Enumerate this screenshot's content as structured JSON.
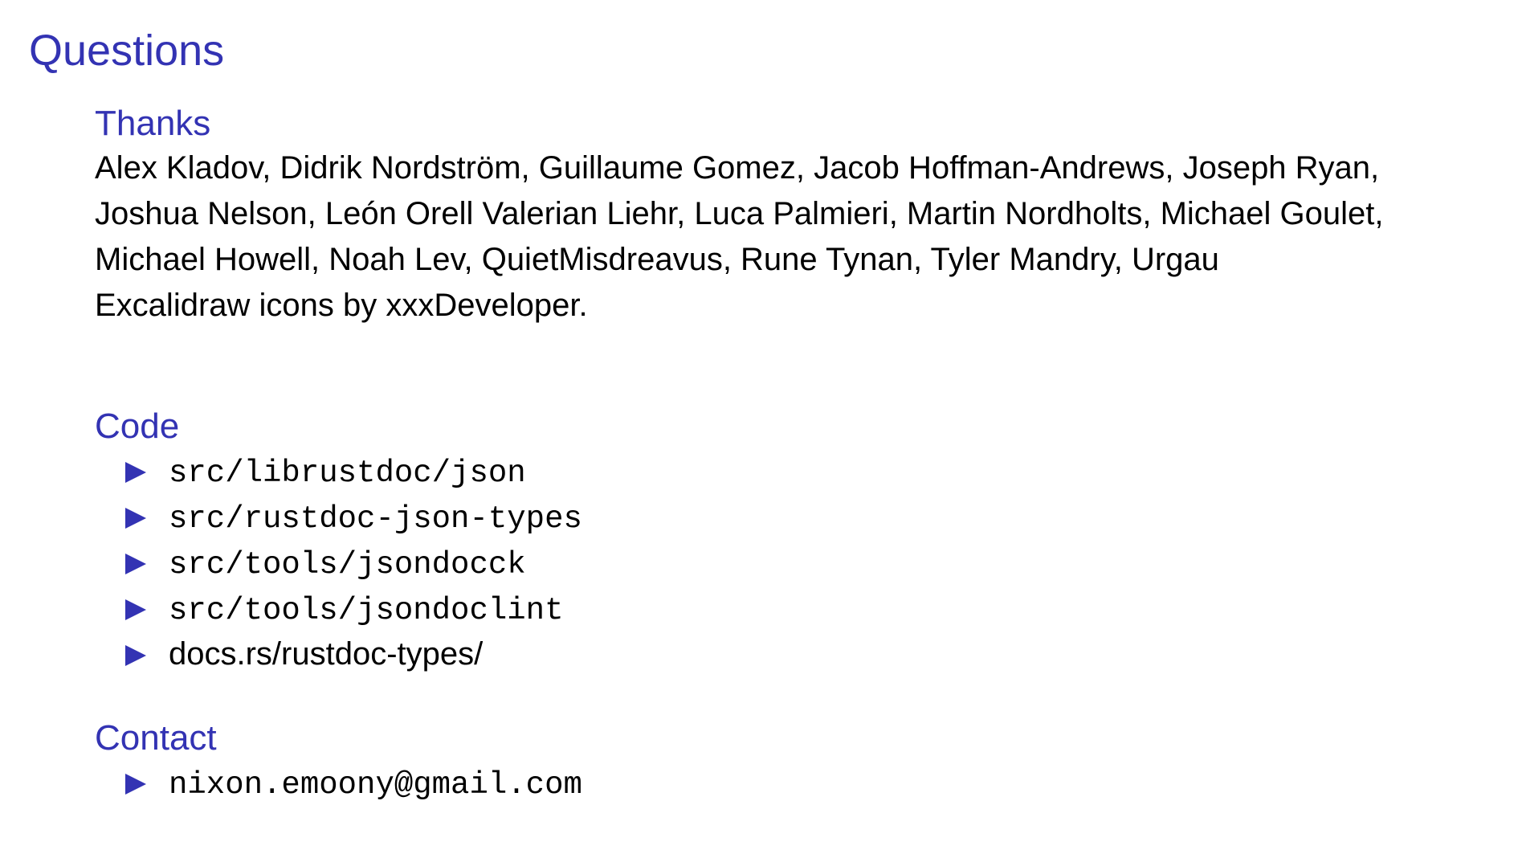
{
  "frame": {
    "title": "Questions"
  },
  "thanks": {
    "heading": "Thanks",
    "credits": "Alex Kladov, Didrik Nordström, Guillaume Gomez, Jacob Hoffman-Andrews, Joseph Ryan, Joshua Nelson, León Orell Valerian Liehr, Luca Palmieri, Martin Nordholts, Michael Goulet, Michael Howell, Noah Lev, QuietMisdreavus, Rune Tynan, Tyler Mandry, Urgau",
    "icons_note": "Excalidraw icons by xxxDeveloper."
  },
  "code": {
    "heading": "Code",
    "items": [
      "src/librustdoc/json",
      "src/rustdoc-json-types",
      "src/tools/jsondocck",
      "src/tools/jsondoclint",
      "docs.rs/rustdoc-types/"
    ]
  },
  "contact": {
    "heading": "Contact",
    "items": [
      "nixon.emoony@gmail.com"
    ]
  },
  "colors": {
    "accent": "#3333b3",
    "text": "#000000",
    "background": "#ffffff"
  }
}
